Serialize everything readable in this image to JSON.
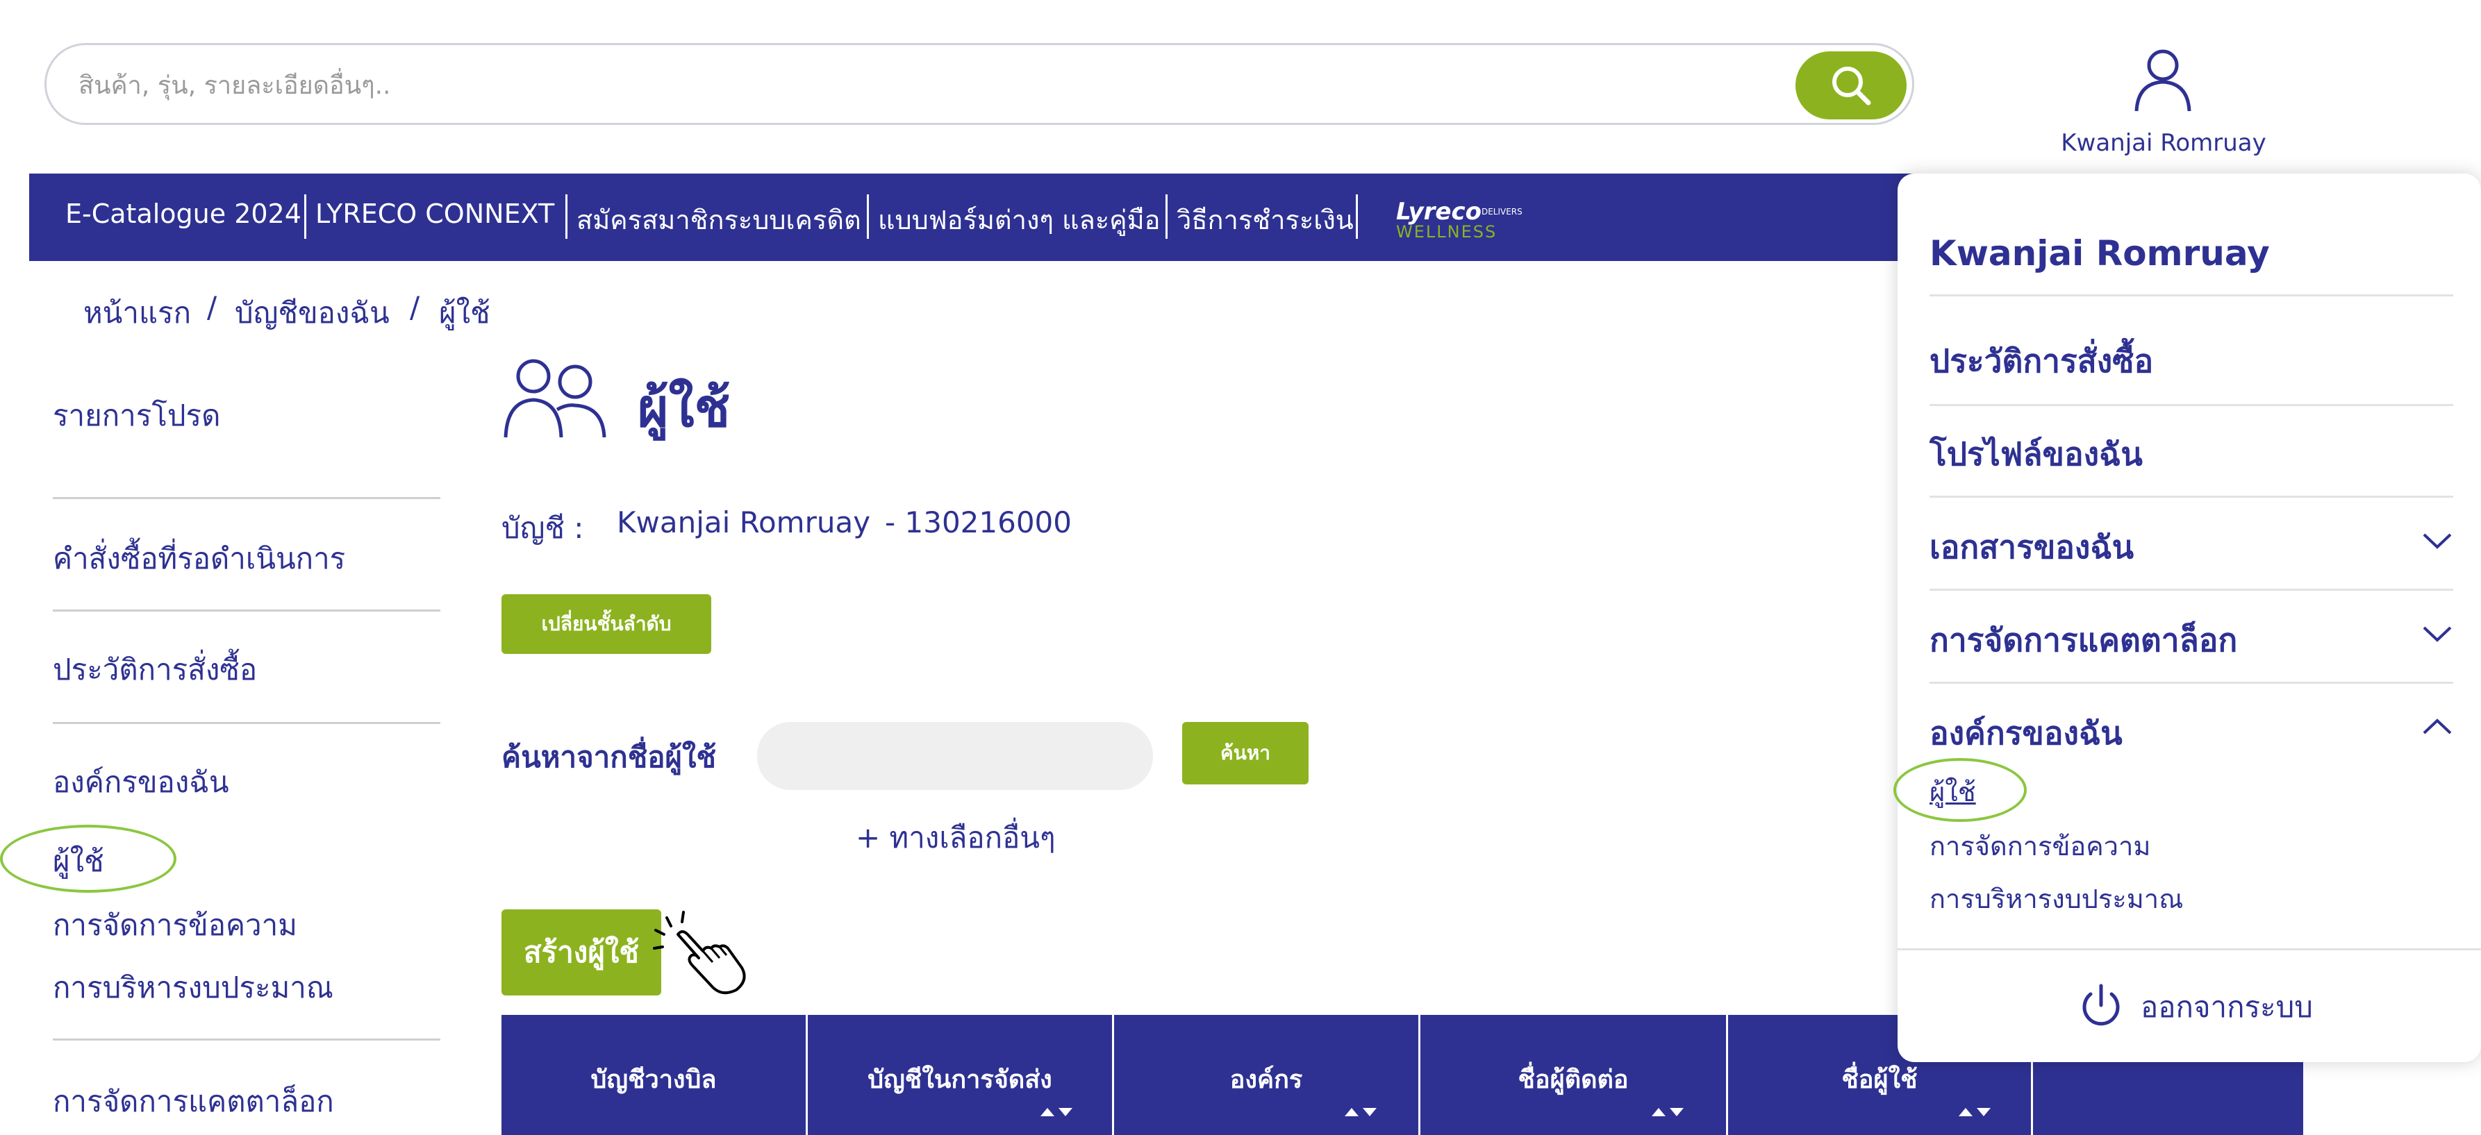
{
  "search": {
    "placeholder": "สินค้า, รุ่น, รายละเอียดอื่นๆ.."
  },
  "user": {
    "name": "Kwanjai Romruay"
  },
  "nav": {
    "items": [
      "E-Catalogue 2024",
      "LYRECO CONNEXT",
      "สมัครสมาชิกระบบเครดิต",
      "แบบฟอร์มต่างๆ และคู่มือ",
      "วิธีการชำระเงิน"
    ],
    "logo_top": "Lyreco",
    "logo_small": "DELIVERS",
    "logo_bottom": "WELLNESS"
  },
  "breadcrumb": {
    "home": "หน้าแรก",
    "sep": "/",
    "account": "บัญชีของฉัน",
    "current": "ผู้ใช้"
  },
  "sidebar": {
    "favorites": "รายการโปรด",
    "pending_orders": "คำสั่งซื้อที่รอดำเนินการ",
    "order_history": "ประวัติการสั่งซื้อ",
    "my_org": "องค์กรของฉัน",
    "users": "ผู้ใช้",
    "message_mgmt": "การจัดการข้อความ",
    "budget_mgmt": "การบริหารงบประมาณ",
    "catalog_mgmt": "การจัดการแคตตาล็อก"
  },
  "main": {
    "title": "ผู้ใช้",
    "account_label": "บัญชี :",
    "account_name": "Kwanjai Romruay",
    "account_number": "- 130216000",
    "change_level_button": "เปลี่ยนชั้นลำดับ",
    "search_user_label": "ค้นหาจากชื่อผู้ใช้",
    "search_button": "ค้นหา",
    "more_options": "+ ทางเลือกอื่นๆ",
    "create_user_button": "สร้างผู้ใช้"
  },
  "table": {
    "headers": [
      "บัญชีวางบิล",
      "บัญชีในการจัดส่ง",
      "องค์กร",
      "ชื่อผู้ติดต่อ",
      "ชื่อผู้ใช้"
    ]
  },
  "dropdown": {
    "name": "Kwanjai Romruay",
    "order_history": "ประวัติการสั่งซื้อ",
    "my_profile": "โปรไฟล์ของฉัน",
    "my_documents": "เอกสารของฉัน",
    "catalog_mgmt": "การจัดการแคตตาล็อก",
    "my_org": "องค์กรของฉัน",
    "users": "ผู้ใช้",
    "message_mgmt": "การจัดการข้อความ",
    "budget_mgmt": "การบริหารงบประมาณ",
    "logout": "ออกจากระบบ"
  },
  "colors": {
    "navy": "#2e3192",
    "green": "#8cb31f",
    "highlight": "#8cc63f"
  }
}
